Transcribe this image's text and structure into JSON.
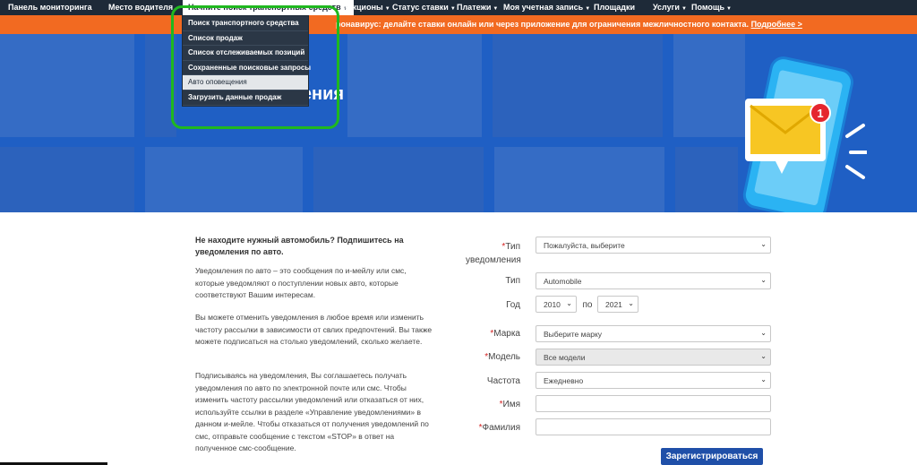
{
  "nav": {
    "items": [
      {
        "label": "Панель мониторинга",
        "caret": false
      },
      {
        "label": "Место водителя",
        "caret": false
      },
      {
        "label": "Начните поиск транспортных средств",
        "caret": true
      },
      {
        "label": "Аукционы",
        "caret": true
      },
      {
        "label": "Статус ставки",
        "caret": true
      },
      {
        "label": "Платежи",
        "caret": true
      },
      {
        "label": "Моя учетная запись",
        "caret": true
      },
      {
        "label": "Площадки",
        "caret": false
      },
      {
        "label": "Услуги",
        "caret": true
      },
      {
        "label": "Помощь",
        "caret": true
      }
    ]
  },
  "banner": {
    "text": "ронавирус: делайте ставки онлайн или через приложение для ограничения межличностного контакта.",
    "link": "Подробнее >"
  },
  "dropdown": {
    "options": [
      "Поиск транспортного средства",
      "Список продаж",
      "Список отслеживаемых позиций",
      "Сохраненные поисковые запросы",
      "Авто оповещения",
      "Загрузить данные продаж"
    ],
    "selected_index": 4
  },
  "hero": {
    "title_visible": "щения",
    "badge": "1"
  },
  "info": {
    "lead": "Не находите нужный автомобиль? Подпишитесь на уведомления по авто.",
    "p1": "Уведомления по авто – это сообщения по и-мейлу или смс, которые уведомляют о поступлении новых авто, которые соответствуют Вашим интересам.",
    "p2": "Вы можете отменить уведомления в любое время или изменить частоту рассылки в зависимости от свлих предпочтений. Вы также можете подписаться на столько уведомлений, сколько желаете.",
    "p3": "Подписываясь на уведомления, Вы соглашаетесь получать уведомления по авто по электронной почте или смс. Чтобы изменить частоту рассылки уведомлений или отказаться от них, используйте ссылки в разделе «Управление уведомлениями» в данном и-мейле. Чтобы отказаться от получения уведомлений по смс, отправьте сообщение с текстом «STOP» в ответ на полученное смс-сообщение."
  },
  "form": {
    "type_label": "Тип уведомления",
    "type_value": "Пожалуйста, выберите",
    "vehicle_label": "Тип",
    "vehicle_value": "Automobile",
    "year_label": "Год",
    "year_from": "2010",
    "year_sep": "по",
    "year_to": "2021",
    "make_label": "Марка",
    "make_value": "Выберите марку",
    "model_label": "Модель",
    "model_value": "Все модели",
    "freq_label": "Частота",
    "freq_value": "Ежедневно",
    "name_label": "Имя",
    "lastname_label": "Фамилия",
    "submit": "Зарегистрироваться",
    "required_mark": "*"
  }
}
